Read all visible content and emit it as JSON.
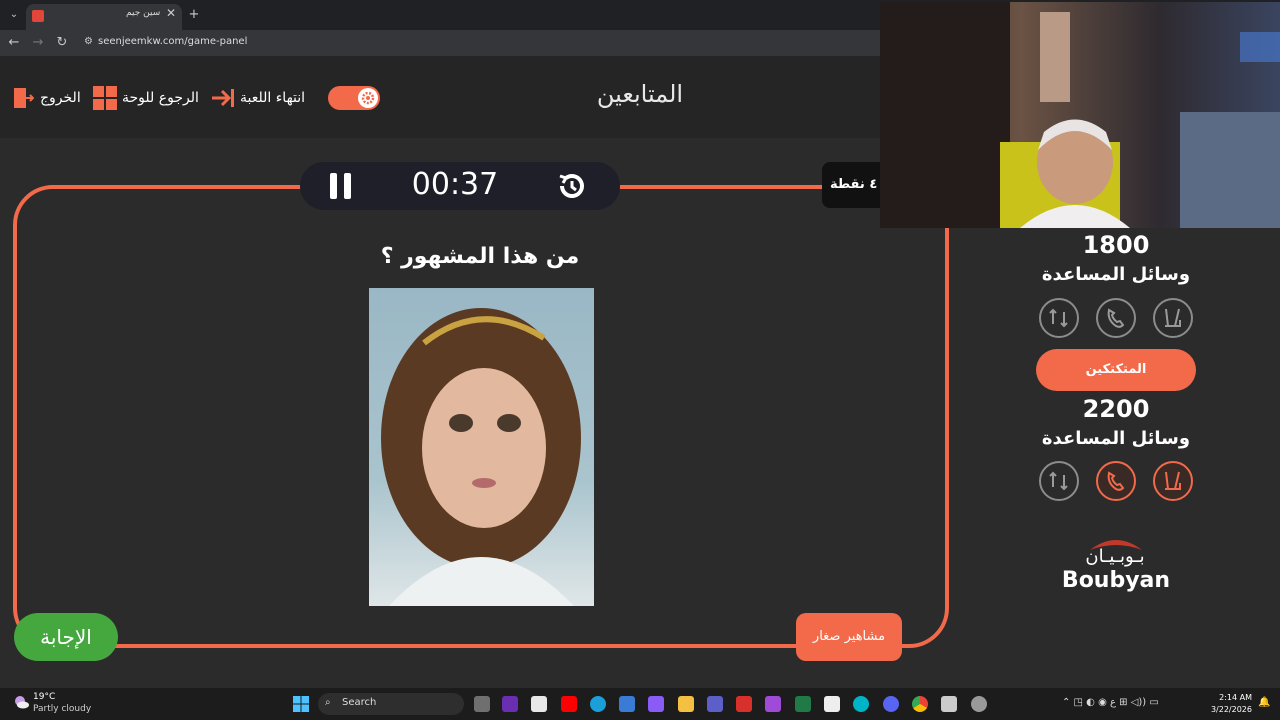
{
  "browser": {
    "tab_title": "سين جيم",
    "new_tab": "+",
    "url": "seenjeemkw.com/game-panel"
  },
  "header": {
    "title": "المتابعين",
    "exit_label": "الخروج",
    "back_to_board_label": "الرجوع للوحة",
    "end_game_label": "انتهاء اللعبة"
  },
  "game": {
    "timer": "00:37",
    "points_badge": "٤٠ نقطة",
    "question": "من هذا المشهور ؟",
    "answer_button": "الإجابة",
    "category": "مشاهير صغار"
  },
  "teams": [
    {
      "name": "المتابعين",
      "score": "1800",
      "aids_label": "وسائل المساعدة",
      "aids_used": [
        false,
        false,
        false
      ]
    },
    {
      "name": "المتكتكين",
      "score": "2200",
      "aids_label": "وسائل المساعدة",
      "aids_used": [
        false,
        true,
        true
      ]
    }
  ],
  "sponsor": {
    "arabic": "بـوبـيـان",
    "english": "Boubyan",
    "color": "#c0392b"
  },
  "accent": "#f26a4a",
  "taskbar": {
    "weather_temp": "19°C",
    "weather_desc": "Partly cloudy",
    "search_label": "Search",
    "time": "2:14 AM",
    "date": "3/22/2026"
  }
}
